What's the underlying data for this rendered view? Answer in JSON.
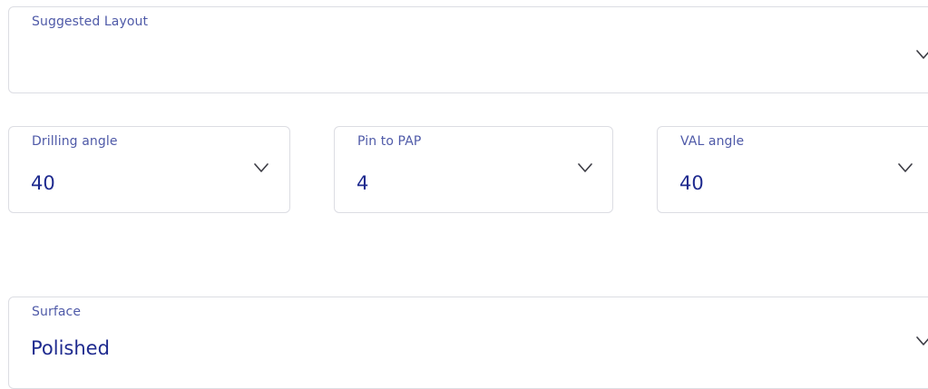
{
  "fields": {
    "suggested_layout": {
      "label": "Suggested Layout",
      "value": ""
    },
    "drilling_angle": {
      "label": "Drilling angle",
      "value": "40"
    },
    "pin_to_pap": {
      "label": "Pin to PAP",
      "value": "4"
    },
    "val_angle": {
      "label": "VAL angle",
      "value": "40"
    },
    "surface": {
      "label": "Surface",
      "value": "Polished"
    }
  },
  "icons": {
    "dropdown": "chevron-down-icon"
  },
  "colors": {
    "label": "#4f5aa8",
    "value": "#1f2b8f",
    "border": "#dcdde3",
    "chevron": "#3c3c44"
  }
}
